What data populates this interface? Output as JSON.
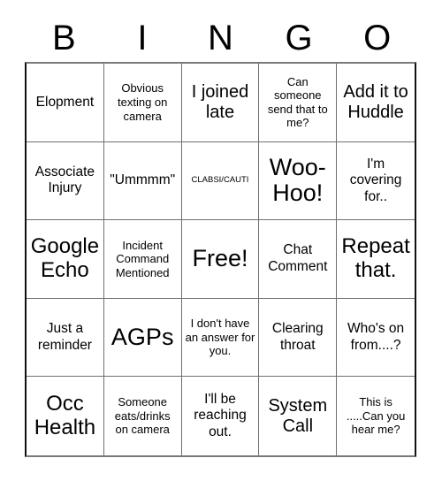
{
  "header": {
    "letters": [
      "B",
      "I",
      "N",
      "G",
      "O"
    ]
  },
  "colors": {
    "background": "#ffffff",
    "text": "#000000",
    "grid_line": "#6f6f6f",
    "grid_outer": "#111111"
  },
  "grid": {
    "rows": 5,
    "columns": 5,
    "free_space_index": 12,
    "cells": [
      {
        "text": "Elopment",
        "size": "fs-md"
      },
      {
        "text": "Obvious texting on camera",
        "size": "fs-sm"
      },
      {
        "text": "I joined late",
        "size": "fs-lg"
      },
      {
        "text": "Can someone send that to me?",
        "size": "fs-sm"
      },
      {
        "text": "Add it to Huddle",
        "size": "fs-lg"
      },
      {
        "text": "Associate Injury",
        "size": "fs-md"
      },
      {
        "text": "\"Ummmm\"",
        "size": "fs-md"
      },
      {
        "text": "CLABSI/CAUTI",
        "size": "fs-xs"
      },
      {
        "text": "Woo-Hoo!",
        "size": "fs-xxl"
      },
      {
        "text": "I'm covering for..",
        "size": "fs-md"
      },
      {
        "text": "Google Echo",
        "size": "fs-xl"
      },
      {
        "text": "Incident Command Mentioned",
        "size": "fs-sm"
      },
      {
        "text": "Free!",
        "size": "fs-xxl"
      },
      {
        "text": "Chat Comment",
        "size": "fs-md"
      },
      {
        "text": "Repeat that.",
        "size": "fs-xl"
      },
      {
        "text": "Just a reminder",
        "size": "fs-md"
      },
      {
        "text": "AGPs",
        "size": "fs-xxl"
      },
      {
        "text": "I don't have an answer for you.",
        "size": "fs-sm"
      },
      {
        "text": "Clearing throat",
        "size": "fs-md"
      },
      {
        "text": "Who's on from....?",
        "size": "fs-md"
      },
      {
        "text": "Occ Health",
        "size": "fs-xl"
      },
      {
        "text": "Someone eats/drinks on camera",
        "size": "fs-sm"
      },
      {
        "text": "I'll be reaching out.",
        "size": "fs-md"
      },
      {
        "text": "System Call",
        "size": "fs-lg"
      },
      {
        "text": "This is .....Can you hear me?",
        "size": "fs-sm"
      }
    ]
  }
}
